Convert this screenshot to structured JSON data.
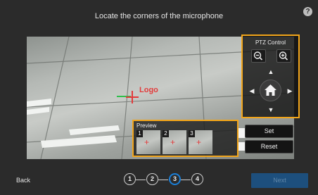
{
  "header": {
    "title": "Locate the corners of the microphone",
    "help_icon": "?"
  },
  "camera": {
    "target_label": "Logo"
  },
  "ptz": {
    "title": "PTZ Control",
    "zoom_out_icon": "zoom-out-icon",
    "zoom_in_icon": "zoom-in-icon",
    "arrow_up": "▲",
    "arrow_down": "▼",
    "arrow_left": "◀",
    "arrow_right": "▶",
    "home_icon": "home-icon"
  },
  "preview": {
    "title": "Preview",
    "thumbnails": [
      {
        "number": "1"
      },
      {
        "number": "2"
      },
      {
        "number": "3"
      }
    ]
  },
  "actions": {
    "set_label": "Set",
    "reset_label": "Reset"
  },
  "footer": {
    "back_label": "Back",
    "steps": [
      "1",
      "2",
      "3",
      "4"
    ],
    "active_step": "3",
    "next_label": "Next"
  },
  "colors": {
    "highlight": "#f2a51a",
    "active_step": "#1a7fd8",
    "next_button": "#1d4f7d",
    "marker": "#e23b3b"
  }
}
